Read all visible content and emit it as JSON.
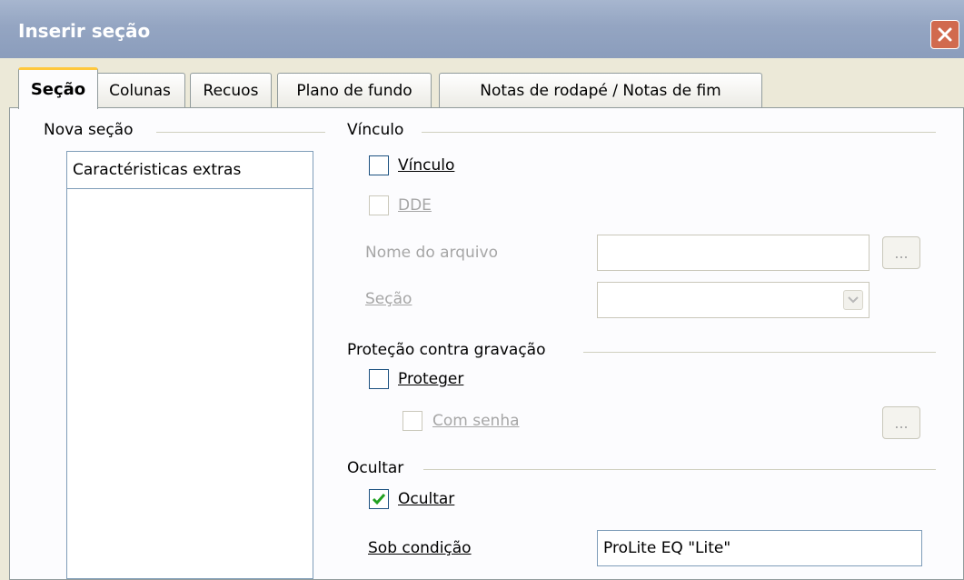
{
  "window": {
    "title": "Inserir seção"
  },
  "tabs": [
    {
      "label": "Seção",
      "active": true
    },
    {
      "label": "Colunas"
    },
    {
      "label": "Recuos"
    },
    {
      "label": "Plano de fundo"
    },
    {
      "label": "Notas de rodapé / Notas de fim"
    }
  ],
  "new_section": {
    "heading": "Nova seção",
    "name_value": "Caractéristicas extras",
    "list_items": []
  },
  "link": {
    "heading": "Vínculo",
    "link_checkbox": {
      "label": "Vínculo",
      "checked": false
    },
    "dde_checkbox": {
      "label": "DDE",
      "checked": false,
      "enabled": false
    },
    "filename_label": "Nome do arquivo",
    "filename_value": "",
    "browse_label": "...",
    "section_label": "Seção",
    "section_value": ""
  },
  "write_protection": {
    "heading": "Proteção contra gravação",
    "protect_checkbox": {
      "label": "Proteger",
      "checked": false
    },
    "password_checkbox": {
      "label": "Com senha",
      "checked": false,
      "enabled": false
    },
    "password_button_label": "..."
  },
  "hide": {
    "heading": "Ocultar",
    "hide_checkbox": {
      "label": "Ocultar",
      "checked": true
    },
    "condition_label": "Sob condição",
    "condition_value": "ProLite EQ \"Lite\""
  },
  "colors": {
    "title_bar": "#94a5c2",
    "close_button": "#d16a4e",
    "active_tab_accent": "#ffc83c",
    "check_mark": "#21a121"
  }
}
